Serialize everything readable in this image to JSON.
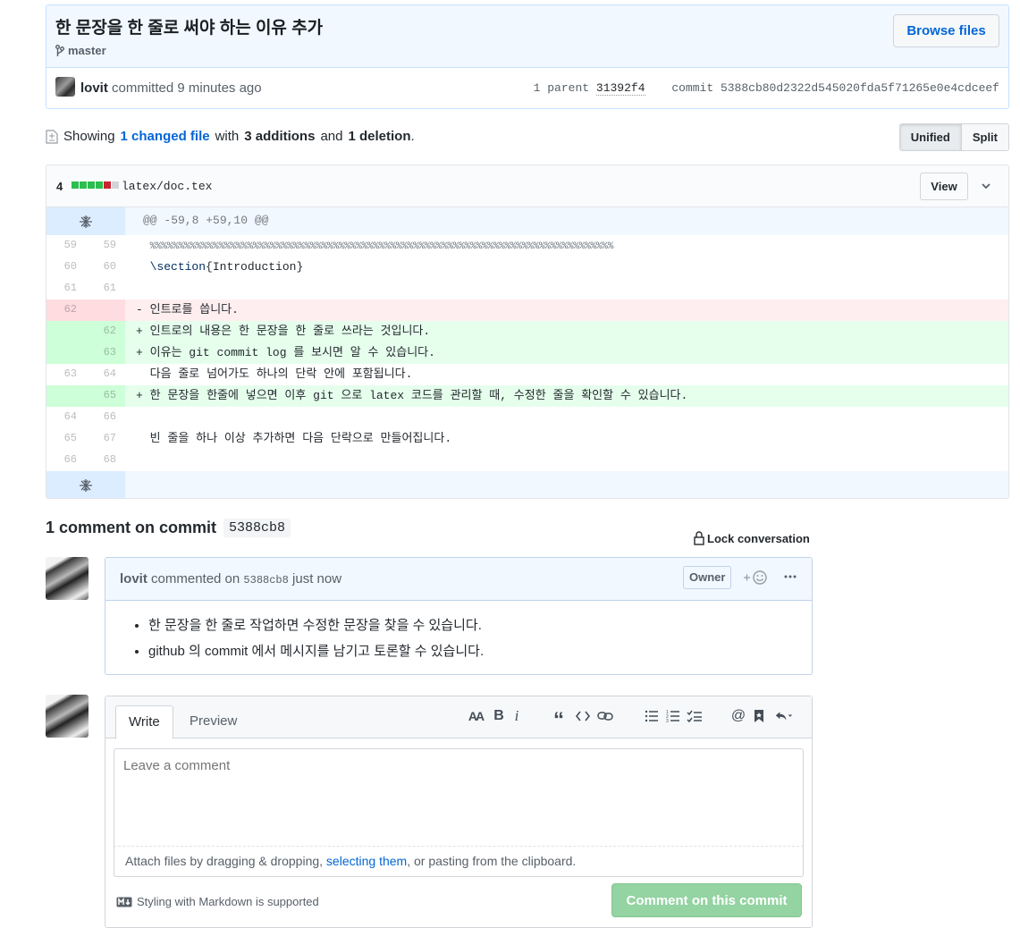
{
  "commit": {
    "title": "한 문장을 한 줄로 써야 하는 이유 추가",
    "branch": "master",
    "browse_label": "Browse files",
    "author": "lovit",
    "action": "committed",
    "time": "9 minutes ago",
    "parent_label": "1 parent",
    "parent_sha": "31392f4",
    "commit_label": "commit",
    "commit_sha": "5388cb80d2322d545020fda5f71265e0e4cdceef"
  },
  "toc": {
    "showing": "Showing",
    "changed_files": "1 changed file",
    "with": "with",
    "additions": "3 additions",
    "and": "and",
    "deletions": "1 deletion",
    "period": ".",
    "unified_label": "Unified",
    "split_label": "Split"
  },
  "file": {
    "count": "4",
    "path": "latex/doc.tex",
    "view_label": "View",
    "diffstat": [
      "#2cbe4e",
      "#2cbe4e",
      "#2cbe4e",
      "#2cbe4e",
      "#cb2431",
      "#d1d5da"
    ],
    "hunk_header": "@@ -59,8 +59,10 @@",
    "lines": [
      {
        "type": "ctx",
        "old": "59",
        "new": "59",
        "prefix": " ",
        "text": "%%%%%%%%%%%%%%%%%%%%%%%%%%%%%%%%%%%%%%%%%%%%%%%%%%%%%%%%%%%%%%%%%%%%%%%%%%%%%%%%%"
      },
      {
        "type": "ctx",
        "old": "60",
        "new": "60",
        "prefix": " ",
        "text": "\\section{Introduction}"
      },
      {
        "type": "ctx",
        "old": "61",
        "new": "61",
        "prefix": " ",
        "text": ""
      },
      {
        "type": "del",
        "old": "62",
        "new": "",
        "prefix": "-",
        "text": "인트로를 씁니다."
      },
      {
        "type": "add",
        "old": "",
        "new": "62",
        "prefix": "+",
        "text": "인트로의 내용은 한 문장을 한 줄로 쓰라는 것입니다."
      },
      {
        "type": "add",
        "old": "",
        "new": "63",
        "prefix": "+",
        "text": "이유는 git commit log 를 보시면 알 수 있습니다."
      },
      {
        "type": "ctx",
        "old": "63",
        "new": "64",
        "prefix": " ",
        "text": "다음 줄로 넘어가도 하나의 단락 안에 포함됩니다."
      },
      {
        "type": "add",
        "old": "",
        "new": "65",
        "prefix": "+",
        "text": "한 문장을 한줄에 넣으면 이후 git 으로 latex 코드를 관리할 때, 수정한 줄을 확인할 수 있습니다."
      },
      {
        "type": "ctx",
        "old": "64",
        "new": "66",
        "prefix": " ",
        "text": ""
      },
      {
        "type": "ctx",
        "old": "65",
        "new": "67",
        "prefix": " ",
        "text": "빈 줄을 하나 이상 추가하면 다음 단락으로 만들어집니다."
      },
      {
        "type": "ctx",
        "old": "66",
        "new": "68",
        "prefix": " ",
        "text": ""
      }
    ]
  },
  "comments": {
    "title": "1 comment on commit",
    "short_sha": "5388cb8",
    "lock_label": "Lock conversation",
    "items": [
      {
        "author": "lovit",
        "action": "commented on",
        "sha": "5388cb8",
        "time": "just now",
        "badge": "Owner",
        "bullets": [
          "한 문장을 한 줄로 작업하면 수정한 문장을 찾을 수 있습니다.",
          "github 의 commit 에서 메시지를 남기고 토론할 수 있습니다."
        ]
      }
    ]
  },
  "new_comment": {
    "write_tab": "Write",
    "preview_tab": "Preview",
    "placeholder": "Leave a comment",
    "attach_before": "Attach files by dragging & dropping, ",
    "attach_link": "selecting them",
    "attach_after": ", or pasting from the clipboard.",
    "markdown_note": "Styling with Markdown is supported",
    "submit_label": "Comment on this commit",
    "toolbar_icons": [
      "text-size-icon",
      "bold-icon",
      "italic-icon",
      "quote-icon",
      "code-icon",
      "link-icon",
      "bullet-list-icon",
      "numbered-list-icon",
      "task-list-icon",
      "mention-icon",
      "saved-reply-icon",
      "reply-icon"
    ]
  }
}
